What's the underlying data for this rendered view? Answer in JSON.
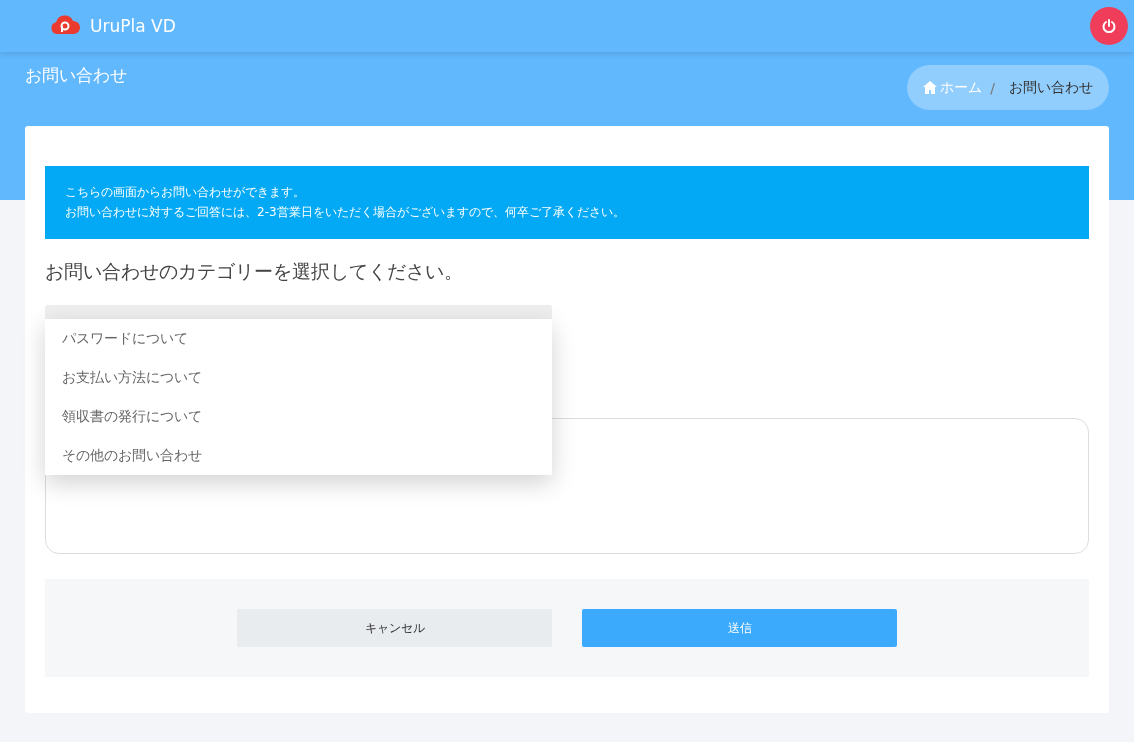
{
  "header": {
    "brand": "UruPla VD"
  },
  "page": {
    "title": "お問い合わせ"
  },
  "breadcrumb": [
    {
      "label": "ホーム",
      "kind": "home"
    },
    {
      "label": "お問い合わせ",
      "kind": "current",
      "separator": "/"
    }
  ],
  "notice": {
    "lines": [
      "こちらの画面からお問い合わせができます。",
      "お問い合わせに対するご回答には、2-3営業日をいただく場合がございますので、何卒ご了承ください。"
    ]
  },
  "form": {
    "category_prompt": "お問い合わせのカテゴリーを選択してください。",
    "category_menu": {
      "expanded": true,
      "options": [
        "パスワードについて",
        "お支払い方法について",
        "領収書の発行について",
        "その他のお問い合わせ"
      ]
    }
  },
  "buttons": [
    {
      "label": "キャンセル",
      "kind": "secondary"
    },
    {
      "label": "送信",
      "kind": "primary"
    }
  ]
}
